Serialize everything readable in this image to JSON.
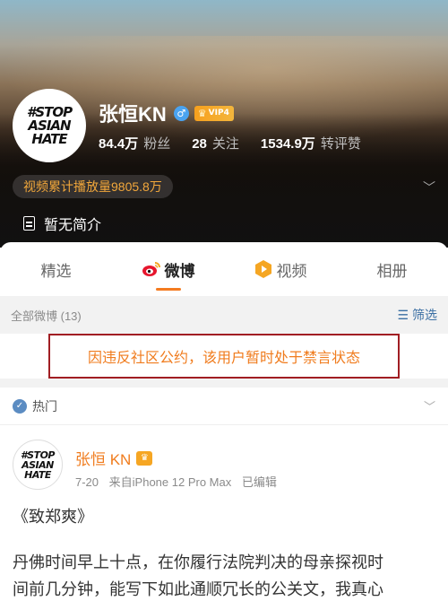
{
  "profile": {
    "name": "张恒KN",
    "vip_label": "VIP4",
    "gender_symbol": "♂",
    "avatar_text": [
      "#STOP",
      "ASIAN",
      "HATE"
    ],
    "stats": [
      {
        "num": "84.4万",
        "label": "粉丝"
      },
      {
        "num": "28",
        "label": "关注"
      },
      {
        "num": "1534.9万",
        "label": "转评赞"
      }
    ],
    "video_plays": "视频累计播放量9805.8万",
    "intro": "暂无简介"
  },
  "tabs": [
    {
      "label": "精选",
      "active": false
    },
    {
      "label": "微博",
      "active": true
    },
    {
      "label": "视频",
      "active": false
    },
    {
      "label": "相册",
      "active": false
    }
  ],
  "filter": {
    "all_label": "全部微博 (13)",
    "filter_label": "筛选"
  },
  "notice": "因违反社区公约，该用户暂时处于禁言状态",
  "hot": {
    "label": "热门"
  },
  "post": {
    "author": "张恒 KN",
    "date": "7-20",
    "source": "来自iPhone 12 Pro Max",
    "edited": "已编辑",
    "title": "《致郑爽》",
    "body": [
      "丹佛时间早上十点，在你履行法院判决的母亲探视时",
      "间前几分钟，能写下如此通顺冗长的公关文，我真心"
    ]
  },
  "colors": {
    "accent_orange": "#f07c1e",
    "notice_border": "#a11e23",
    "link_blue": "#3b6fa3"
  }
}
